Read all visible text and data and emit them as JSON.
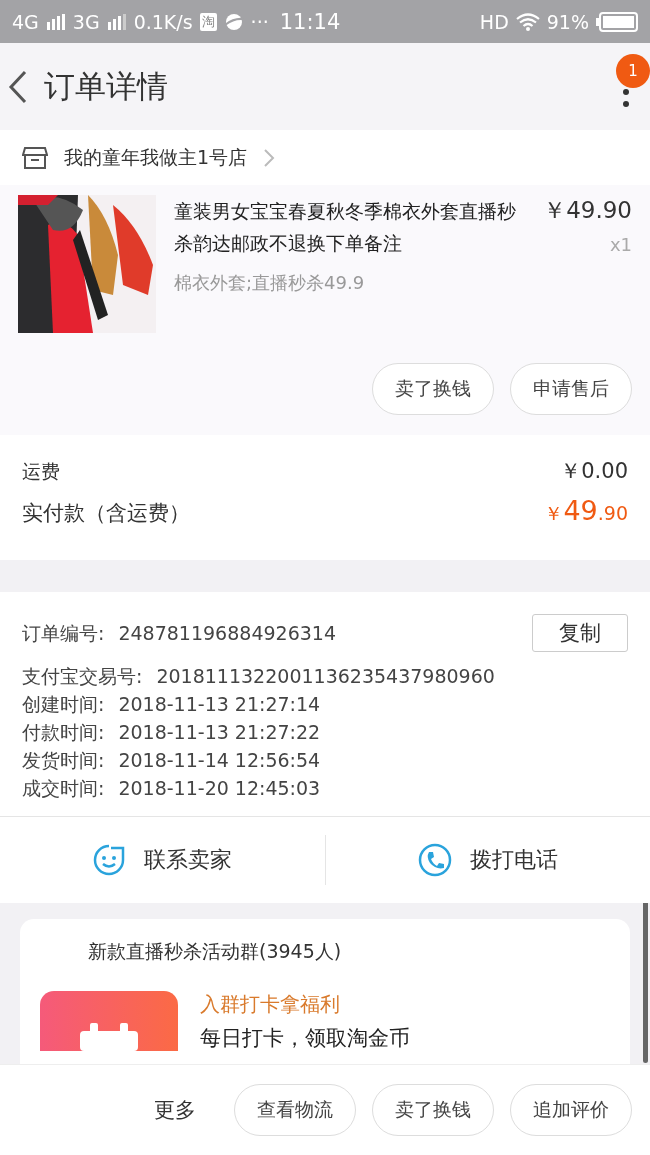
{
  "status_bar": {
    "network_1": "4G",
    "network_2": "3G",
    "speed": "0.1K/s",
    "app_badge": "淘",
    "more": "···",
    "time": "11:14",
    "hd": "HD",
    "battery": "91%"
  },
  "header": {
    "title": "订单详情",
    "badge": "1"
  },
  "shop": {
    "name": "我的童年我做主1号店"
  },
  "product": {
    "title": "童装男女宝宝春夏秋冬季棉衣外套直播秒杀韵达邮政不退换下单备注",
    "sku": "棉衣外套;直播秒杀49.9",
    "price": "￥49.90",
    "quantity": "x1",
    "buttons": [
      "卖了换钱",
      "申请售后"
    ]
  },
  "fees": {
    "shipping_label": "运费",
    "shipping_value": "￥0.00",
    "paid_label": "实付款（含运费）",
    "paid_currency": "￥",
    "paid_int": "49",
    "paid_dec": ".90"
  },
  "order_info": {
    "copy_button": "复制",
    "rows": [
      {
        "label": "订单编号:",
        "value": "248781196884926314"
      },
      {
        "label": "支付宝交易号:",
        "value": "2018111322001136235437980960"
      },
      {
        "label": "创建时间:",
        "value": "2018-11-13 21:27:14"
      },
      {
        "label": "付款时间:",
        "value": "2018-11-13 21:27:22"
      },
      {
        "label": "发货时间:",
        "value": "2018-11-14 12:56:54"
      },
      {
        "label": "成交时间:",
        "value": "2018-11-20 12:45:03"
      }
    ]
  },
  "contact": [
    {
      "kind": "chat",
      "label": "联系卖家"
    },
    {
      "kind": "phone",
      "label": "拨打电话"
    }
  ],
  "group_card": {
    "title": "新款直播秒杀活动群(3945人)",
    "promo_title": "入群打卡拿福利",
    "promo_text": "每日打卡，领取淘金币"
  },
  "bottom_bar": {
    "more": "更多",
    "buttons": [
      "查看物流",
      "卖了换钱",
      "追加评价"
    ]
  }
}
